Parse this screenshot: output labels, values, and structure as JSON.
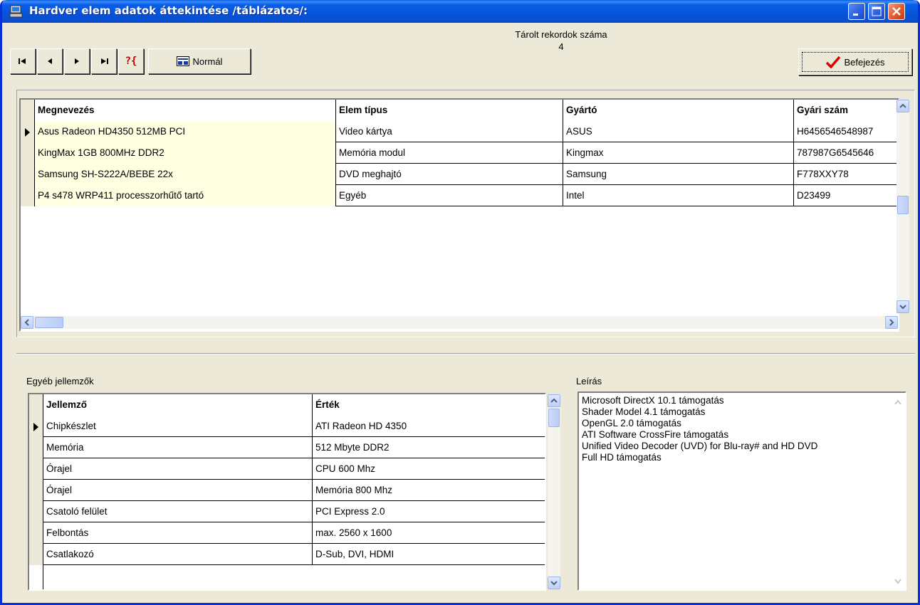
{
  "window": {
    "title": "Hardver elem adatok áttekintése /táblázatos/:",
    "title_color": "#0a5fe7",
    "close_color": "#e25a2e"
  },
  "toolbar": {
    "first_icon": "first-record-icon",
    "prev_icon": "prev-record-icon",
    "next_icon": "next-record-icon",
    "last_icon": "last-record-icon",
    "search_glyph": "?{",
    "normal_label": "Normál",
    "records_label": "Tárolt rekordok száma",
    "records_count": "4",
    "finish_label": "Befejezés"
  },
  "main_table": {
    "headers": [
      "Megnevezés",
      "Elem típus",
      "Gyártó",
      "Gyári szám"
    ],
    "rows": [
      [
        "Asus Radeon HD4350 512MB PCI",
        "Video kártya",
        "ASUS",
        "H6456546548987"
      ],
      [
        "KingMax 1GB 800MHz DDR2",
        "Memória modul",
        "Kingmax",
        "787987G6545646"
      ],
      [
        "Samsung SH-S222A/BEBE 22x",
        "DVD meghajtó",
        "Samsung",
        "F778XXY78"
      ],
      [
        "P4 s478 WRP411 processzorhűtő tartó",
        "Egyéb",
        "Intel",
        "D23499"
      ]
    ]
  },
  "props": {
    "section_label": "Egyéb jellemzők",
    "headers": [
      "Jellemző",
      "Érték"
    ],
    "rows": [
      [
        "Chipkészlet",
        "ATI Radeon HD 4350"
      ],
      [
        "Memória",
        "512 Mbyte DDR2"
      ],
      [
        "Órajel",
        "CPU 600 Mhz"
      ],
      [
        "Órajel",
        "Memória 800 Mhz"
      ],
      [
        "Csatoló felület",
        "PCI Express 2.0"
      ],
      [
        "Felbontás",
        "max. 2560 x 1600"
      ],
      [
        "Csatlakozó",
        "D-Sub, DVI, HDMI"
      ]
    ]
  },
  "description": {
    "section_label": "Leírás",
    "lines": [
      "Microsoft DirectX 10.1 támogatás",
      "Shader Model 4.1 támogatás",
      "OpenGL 2.0 támogatás",
      "ATI Software CrossFire támogatás",
      "Unified Video Decoder (UVD) for Blu-ray# and HD DVD",
      "Full HD támogatás"
    ]
  }
}
